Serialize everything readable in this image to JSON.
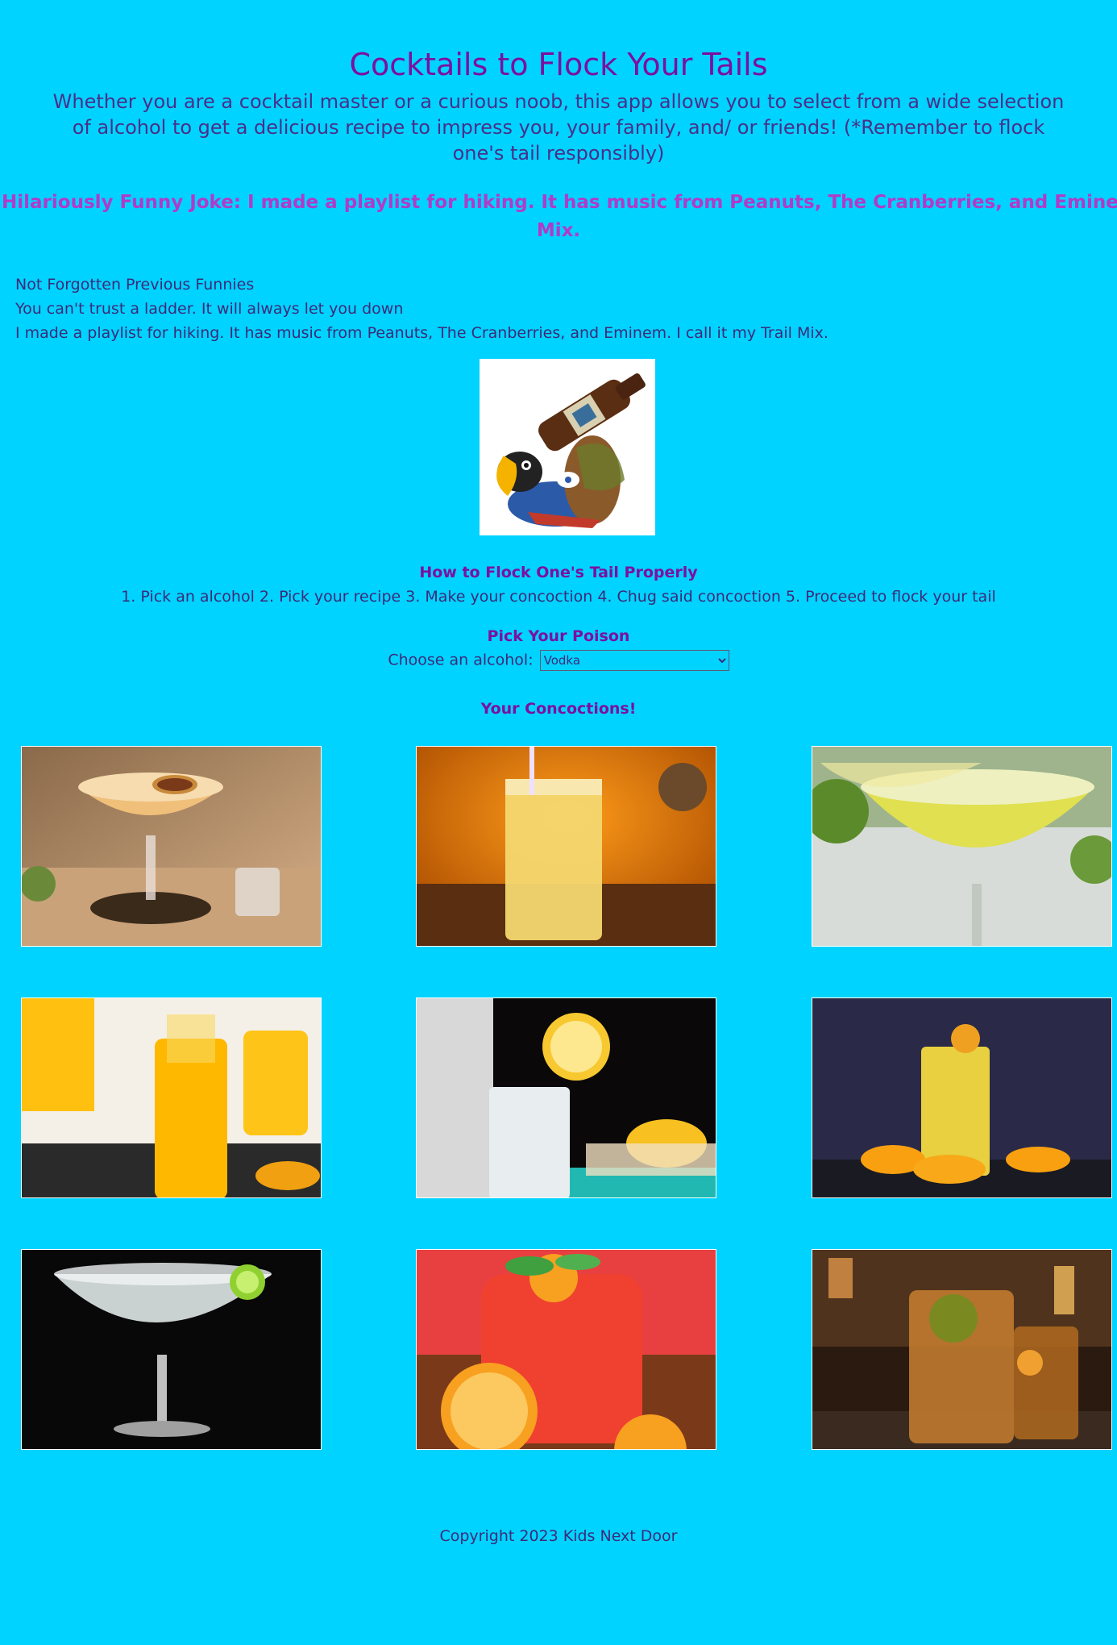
{
  "header": {
    "title": "Cocktails to Flock Your Tails",
    "subtitle": "Whether you are a cocktail master or a curious noob, this app allows you to select from a wide selection of alcohol to get a delicious recipe to impress you, your family, and/ or friends! (*Remember to flock one's tail responsibly)"
  },
  "joke": {
    "line1": "Hilariously Funny Joke: I made a playlist for hiking. It has music from Peanuts, The Cranberries, and Eminem. I call it my Trail",
    "line2": "Mix."
  },
  "previous_funnies": {
    "heading": "Not Forgotten Previous Funnies",
    "items": [
      "You can't trust a ladder. It will always let you down",
      "I made a playlist for hiking. It has music from Peanuts, The Cranberries, and Eminem. I call it my Trail Mix."
    ]
  },
  "howto": {
    "heading": "How to Flock One's Tail Properly",
    "steps": "1. Pick an alcohol 2. Pick your recipe 3. Make your concoction 4. Chug said concoction 5. Proceed to flock your tail"
  },
  "picker": {
    "heading": "Pick Your Poison",
    "label": "Choose an alcohol:",
    "selected": "Vodka"
  },
  "concoctions": {
    "heading": "Your Concoctions!",
    "items": [
      {
        "icon": "passionfruit-martini-image"
      },
      {
        "icon": "screwdriver-highball-image"
      },
      {
        "icon": "lemon-drop-martini-image"
      },
      {
        "icon": "orange-juice-cocktail-image"
      },
      {
        "icon": "vodka-lemonade-image"
      },
      {
        "icon": "orange-highball-image"
      },
      {
        "icon": "vodka-gimlet-image"
      },
      {
        "icon": "red-punch-image"
      },
      {
        "icon": "long-island-iced-tea-image"
      }
    ]
  },
  "footer": {
    "copyright": "Copyright 2023 Kids Next Door"
  },
  "colors": {
    "background": "#00d3ff",
    "title": "#7d0fa0",
    "joke": "#b23ac8",
    "body_text": "#3d2a7a"
  }
}
